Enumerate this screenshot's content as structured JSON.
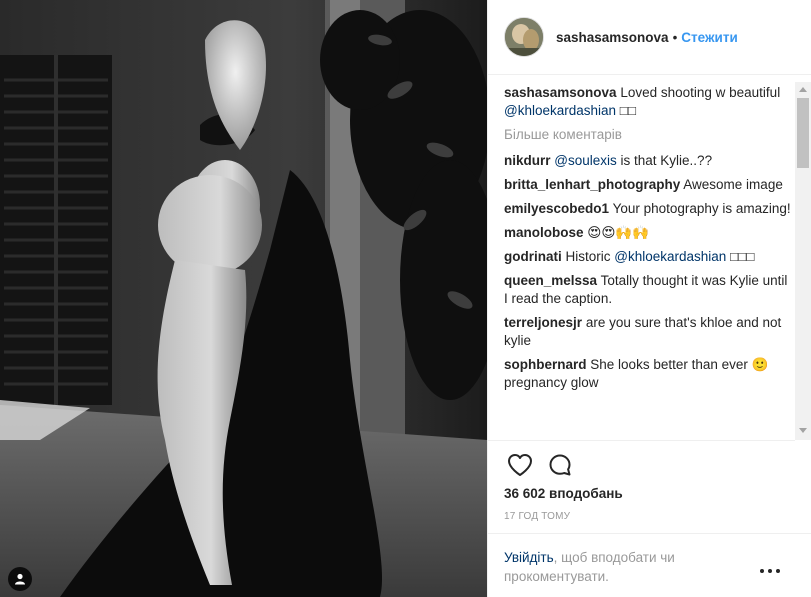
{
  "post": {
    "username": "sashasamsonova",
    "separator": "•",
    "follow_label": "Стежити"
  },
  "caption": {
    "author": "sashasamsonova",
    "text": "Loved shooting w beautiful",
    "mention": "@khloekardashian",
    "emoji": "□□"
  },
  "load_more": "Більше коментарів",
  "comments": [
    {
      "author": "nikdurr",
      "mention": "@soulexis",
      "text": "is that Kylie..??",
      "mention_first": true
    },
    {
      "author": "britta_lenhart_photography",
      "text": "Awesome image"
    },
    {
      "author": "emilyescobedo1",
      "text": "Your photography is amazing!"
    },
    {
      "author": "manolobose",
      "text": "😍😍🙌🙌"
    },
    {
      "author": "godrinati",
      "text": "Historic",
      "mention": "@khloekardashian",
      "suffix": "□□□"
    },
    {
      "author": "queen_melssa",
      "text": "Totally thought it was Kylie until I read the caption."
    },
    {
      "author": "terreljonesjr",
      "text": "are you sure that's khloe and not kylie"
    },
    {
      "author": "sophbernard",
      "text": "She looks better than ever 🙂 pregnancy glow"
    }
  ],
  "actions": {
    "like_icon": "heart-icon",
    "comment_icon": "comment-bubble-icon"
  },
  "likes_text": "36 602 вподобань",
  "timestamp": "17 ГОД ТОМУ",
  "login_prompt": {
    "link_text": "Увійдіть",
    "rest_text": ", щоб вподобати чи прокоментувати."
  },
  "colors": {
    "link_blue": "#3897f0",
    "mention_blue": "#003569",
    "muted": "#999999"
  }
}
